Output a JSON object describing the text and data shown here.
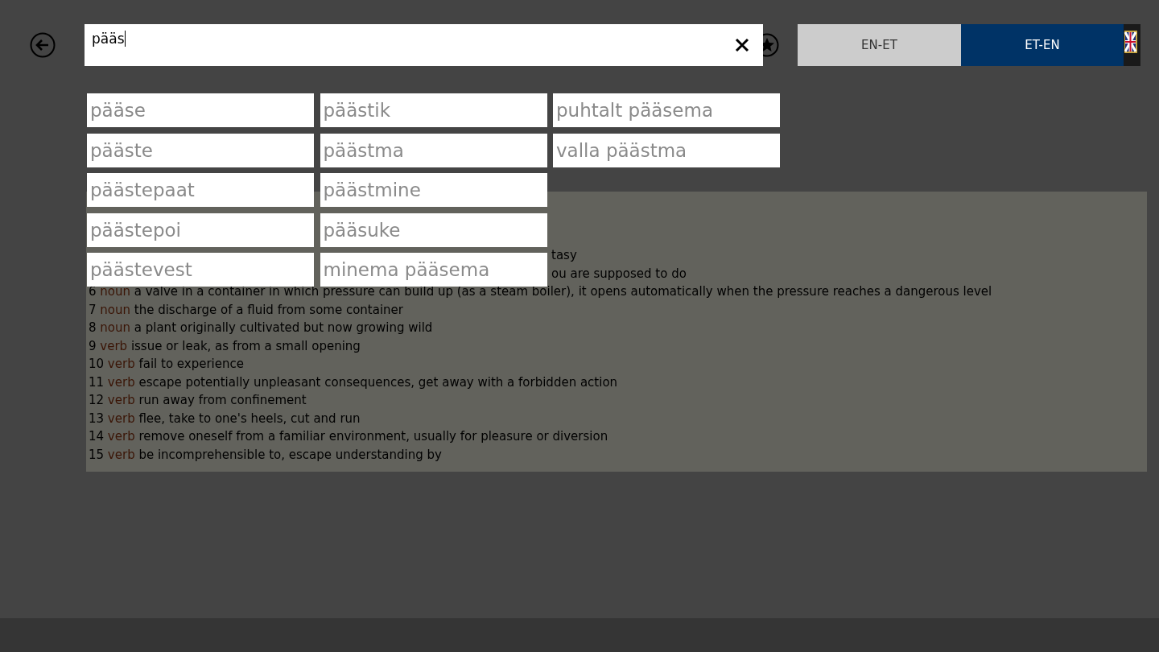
{
  "search": {
    "value": "pääs"
  },
  "tabs": [
    {
      "label": "EN-ET",
      "selected": false
    },
    {
      "label": "ET-EN",
      "selected": true
    }
  ],
  "suggestions": [
    "pääse",
    "pääste",
    "päästepaat",
    "päästepoi",
    "päästevest",
    "päästik",
    "päästma",
    "päästmine",
    "pääsuke",
    "minema pääsema",
    "puhtalt pääsema",
    "valla päästma"
  ],
  "definitions": [
    {
      "kind": "fragment",
      "text": "tasy"
    },
    {
      "kind": "fragment",
      "text": "ou are supposed to do"
    },
    {
      "kind": "entry",
      "number": "6",
      "pos": "noun",
      "text": "a valve in a container in which pressure can build up (as a steam boiler), it opens automatically when the pressure reaches a dangerous level"
    },
    {
      "kind": "entry",
      "number": "7",
      "pos": "noun",
      "text": "the discharge of a fluid from some container"
    },
    {
      "kind": "entry",
      "number": "8",
      "pos": "noun",
      "text": "a plant originally cultivated but now growing wild"
    },
    {
      "kind": "entry",
      "number": "9",
      "pos": "verb",
      "text": "issue or leak, as from a small opening"
    },
    {
      "kind": "entry",
      "number": "10",
      "pos": "verb",
      "text": "fail to experience"
    },
    {
      "kind": "entry",
      "number": "11",
      "pos": "verb",
      "text": "escape potentially unpleasant consequences, get away with a forbidden action"
    },
    {
      "kind": "entry",
      "number": "12",
      "pos": "verb",
      "text": "run away from confinement"
    },
    {
      "kind": "entry",
      "number": "13",
      "pos": "verb",
      "text": "flee, take to one's heels, cut and run"
    },
    {
      "kind": "entry",
      "number": "14",
      "pos": "verb",
      "text": "remove oneself from a familiar environment, usually for pleasure or diversion"
    },
    {
      "kind": "entry",
      "number": "15",
      "pos": "verb",
      "text": "be incomprehensible to, escape understanding by"
    }
  ]
}
